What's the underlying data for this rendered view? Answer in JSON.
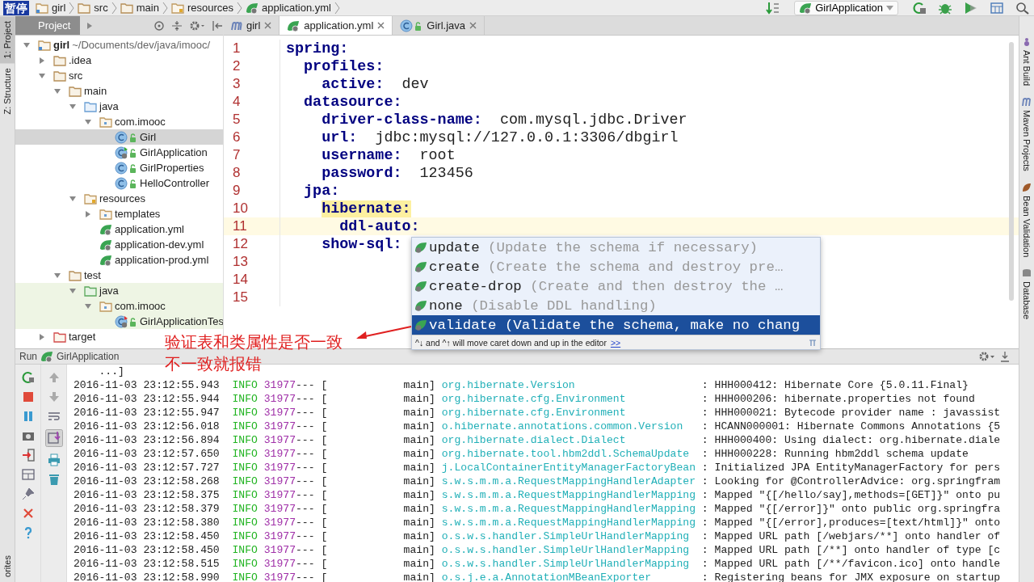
{
  "overlay_label": "暂停",
  "breadcrumbs": [
    {
      "label": "girl",
      "kind": "module"
    },
    {
      "label": "src",
      "kind": "folder"
    },
    {
      "label": "main",
      "kind": "folder"
    },
    {
      "label": "resources",
      "kind": "resources"
    },
    {
      "label": "application.yml",
      "kind": "yml"
    }
  ],
  "run_config": {
    "label": "GirlApplication"
  },
  "left_strip": [
    {
      "label": "1: Project",
      "selected": true
    },
    {
      "label": "Z: Structure",
      "selected": false
    },
    {
      "label": "orites",
      "selected": false
    }
  ],
  "right_strip": [
    {
      "label": "Ant Build",
      "kind": "ant"
    },
    {
      "label": "Maven Projects",
      "kind": "maven"
    },
    {
      "label": "Bean Validation",
      "kind": "bean"
    },
    {
      "label": "Database",
      "kind": "database"
    }
  ],
  "project": {
    "title": "Project",
    "tree": [
      {
        "label": "girl",
        "path": "~/Documents/dev/java/imooc/",
        "kind": "module",
        "expanded": true,
        "selected": false,
        "children": [
          {
            "label": ".idea",
            "kind": "folder",
            "expanded": false,
            "selected": false
          },
          {
            "label": "src",
            "kind": "folder",
            "expanded": true,
            "selected": false,
            "children": [
              {
                "label": "main",
                "kind": "folder",
                "expanded": true,
                "selected": false,
                "children": [
                  {
                    "label": "java",
                    "kind": "source",
                    "expanded": true,
                    "selected": false,
                    "children": [
                      {
                        "label": "com.imooc",
                        "kind": "package",
                        "expanded": true,
                        "selected": false,
                        "children": [
                          {
                            "label": "Girl",
                            "kind": "class",
                            "selected": true
                          },
                          {
                            "label": "GirlApplication",
                            "kind": "app-class",
                            "selected": false
                          },
                          {
                            "label": "GirlProperties",
                            "kind": "class",
                            "selected": false
                          },
                          {
                            "label": "HelloController",
                            "kind": "class",
                            "selected": false
                          }
                        ]
                      }
                    ]
                  },
                  {
                    "label": "resources",
                    "kind": "resources",
                    "expanded": true,
                    "selected": false,
                    "children": [
                      {
                        "label": "templates",
                        "kind": "package",
                        "expanded": false,
                        "selected": false
                      },
                      {
                        "label": "application.yml",
                        "kind": "yml",
                        "selected": false
                      },
                      {
                        "label": "application-dev.yml",
                        "kind": "yml",
                        "selected": false
                      },
                      {
                        "label": "application-prod.yml",
                        "kind": "yml",
                        "selected": false
                      }
                    ]
                  }
                ]
              },
              {
                "label": "test",
                "kind": "folder",
                "expanded": true,
                "selected": false,
                "children": [
                  {
                    "label": "java",
                    "kind": "test-source",
                    "test_source": true,
                    "expanded": true,
                    "selected": false,
                    "children": [
                      {
                        "label": "com.imooc",
                        "kind": "package",
                        "test_source": true,
                        "expanded": true,
                        "selected": false,
                        "children": [
                          {
                            "label": "GirlApplicationTes",
                            "kind": "test-class",
                            "test_source": true,
                            "selected": false
                          }
                        ]
                      }
                    ]
                  }
                ]
              }
            ]
          },
          {
            "label": "target",
            "kind": "excluded",
            "expanded": false,
            "selected": false
          }
        ]
      }
    ]
  },
  "editor_tabs": [
    {
      "label": "girl",
      "kind": "maven",
      "selected": false
    },
    {
      "label": "application.yml",
      "kind": "yml",
      "selected": true
    },
    {
      "label": "Girl.java",
      "kind": "class",
      "selected": false
    }
  ],
  "line_numbers": [
    "1",
    "2",
    "3",
    "4",
    "5",
    "6",
    "7",
    "8",
    "9",
    "10",
    "11",
    "12",
    "13",
    "14",
    "15"
  ],
  "yaml": [
    {
      "key": "spring:",
      "children": [
        {
          "key": "profiles:",
          "children": [
            {
              "key": "active:",
              "value": "dev"
            }
          ]
        },
        {
          "key": "datasource:",
          "children": [
            {
              "key": "driver-class-name:",
              "value": "com.mysql.jdbc.Driver"
            },
            {
              "key": "url:",
              "value": "jdbc:mysql://127.0.0.1:3306/dbgirl"
            },
            {
              "key": "username:",
              "value": "root"
            },
            {
              "key": "password:",
              "value": "123456"
            }
          ]
        },
        {
          "key": "jpa:",
          "children": [
            {
              "key": "hibernate:",
              "highlighted": true,
              "children": [
                {
                  "key": "ddl-auto:",
                  "current": true
                }
              ]
            },
            {
              "key": "show-sql:"
            }
          ]
        }
      ]
    }
  ],
  "completion": {
    "items": [
      {
        "name": "update",
        "description": "(Update the schema if necessary)",
        "selected": false
      },
      {
        "name": "create",
        "description": "(Create the schema and destroy pre…",
        "selected": false
      },
      {
        "name": "create-drop",
        "description": "(Create and then destroy the …",
        "selected": false
      },
      {
        "name": "none",
        "description": "(Disable DDL handling)",
        "selected": false
      },
      {
        "name": "validate",
        "description": "(Validate the schema, make no chang",
        "selected": true
      }
    ],
    "hint": "^↓ and ^↑ will move caret down and up in the editor",
    "hint_link": ">>"
  },
  "annotation": {
    "lines": [
      "验证表和类属性是否一致",
      "不一致就报错"
    ]
  },
  "run_panel": {
    "label": "Run",
    "config": "GirlApplication",
    "first_line": "...]",
    "log": [
      {
        "time": "2016-11-03 23:12:55.943",
        "level": "INFO",
        "pid": "31977",
        "dashes": "--- [",
        "thread": "main]",
        "logger": "org.hibernate.Version",
        "message": ": HHH000412: Hibernate Core {5.0.11.Final}"
      },
      {
        "time": "2016-11-03 23:12:55.944",
        "level": "INFO",
        "pid": "31977",
        "dashes": "--- [",
        "thread": "main]",
        "logger": "org.hibernate.cfg.Environment",
        "message": ": HHH000206: hibernate.properties not found"
      },
      {
        "time": "2016-11-03 23:12:55.947",
        "level": "INFO",
        "pid": "31977",
        "dashes": "--- [",
        "thread": "main]",
        "logger": "org.hibernate.cfg.Environment",
        "message": ": HHH000021: Bytecode provider name : javassist"
      },
      {
        "time": "2016-11-03 23:12:56.018",
        "level": "INFO",
        "pid": "31977",
        "dashes": "--- [",
        "thread": "main]",
        "logger": "o.hibernate.annotations.common.Version",
        "message": ": HCANN000001: Hibernate Commons Annotations {5"
      },
      {
        "time": "2016-11-03 23:12:56.894",
        "level": "INFO",
        "pid": "31977",
        "dashes": "--- [",
        "thread": "main]",
        "logger": "org.hibernate.dialect.Dialect",
        "message": ": HHH000400: Using dialect: org.hibernate.diale"
      },
      {
        "time": "2016-11-03 23:12:57.650",
        "level": "INFO",
        "pid": "31977",
        "dashes": "--- [",
        "thread": "main]",
        "logger": "org.hibernate.tool.hbm2ddl.SchemaUpdate",
        "message": ": HHH000228: Running hbm2ddl schema update"
      },
      {
        "time": "2016-11-03 23:12:57.727",
        "level": "INFO",
        "pid": "31977",
        "dashes": "--- [",
        "thread": "main]",
        "logger": "j.LocalContainerEntityManagerFactoryBean",
        "message": ": Initialized JPA EntityManagerFactory for pers"
      },
      {
        "time": "2016-11-03 23:12:58.268",
        "level": "INFO",
        "pid": "31977",
        "dashes": "--- [",
        "thread": "main]",
        "logger": "s.w.s.m.m.a.RequestMappingHandlerAdapter",
        "message": ": Looking for @ControllerAdvice: org.springfram"
      },
      {
        "time": "2016-11-03 23:12:58.375",
        "level": "INFO",
        "pid": "31977",
        "dashes": "--- [",
        "thread": "main]",
        "logger": "s.w.s.m.m.a.RequestMappingHandlerMapping",
        "message": ": Mapped \"{[/hello/say],methods=[GET]}\" onto pu"
      },
      {
        "time": "2016-11-03 23:12:58.379",
        "level": "INFO",
        "pid": "31977",
        "dashes": "--- [",
        "thread": "main]",
        "logger": "s.w.s.m.m.a.RequestMappingHandlerMapping",
        "message": ": Mapped \"{[/error]}\" onto public org.springfra"
      },
      {
        "time": "2016-11-03 23:12:58.380",
        "level": "INFO",
        "pid": "31977",
        "dashes": "--- [",
        "thread": "main]",
        "logger": "s.w.s.m.m.a.RequestMappingHandlerMapping",
        "message": ": Mapped \"{[/error],produces=[text/html]}\" onto"
      },
      {
        "time": "2016-11-03 23:12:58.450",
        "level": "INFO",
        "pid": "31977",
        "dashes": "--- [",
        "thread": "main]",
        "logger": "o.s.w.s.handler.SimpleUrlHandlerMapping",
        "message": ": Mapped URL path [/webjars/**] onto handler of"
      },
      {
        "time": "2016-11-03 23:12:58.450",
        "level": "INFO",
        "pid": "31977",
        "dashes": "--- [",
        "thread": "main]",
        "logger": "o.s.w.s.handler.SimpleUrlHandlerMapping",
        "message": ": Mapped URL path [/**] onto handler of type [c"
      },
      {
        "time": "2016-11-03 23:12:58.515",
        "level": "INFO",
        "pid": "31977",
        "dashes": "--- [",
        "thread": "main]",
        "logger": "o.s.w.s.handler.SimpleUrlHandlerMapping",
        "message": ": Mapped URL path [/**/favicon.ico] onto handle"
      },
      {
        "time": "2016-11-03 23:12:58.990",
        "level": "INFO",
        "pid": "31977",
        "dashes": "--- [",
        "thread": "main]",
        "logger": "o.s.j.e.a.AnnotationMBeanExporter",
        "message": ": Registering beans for JMX exposure on startup"
      }
    ]
  }
}
